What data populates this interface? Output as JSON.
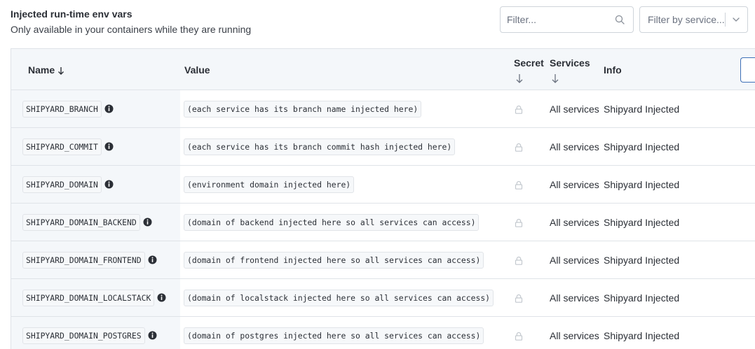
{
  "header": {
    "title": "Injected run-time env vars",
    "subtitle": "Only available in your containers while they are running"
  },
  "filters": {
    "filter_placeholder": "Filter...",
    "service_placeholder": "Filter by service..."
  },
  "table": {
    "columns": {
      "name": "Name",
      "value": "Value",
      "secret": "Secret",
      "services": "Services",
      "info": "Info"
    },
    "rows": [
      {
        "name": "SHIPYARD_BRANCH",
        "value": "(each service has its branch name injected here)",
        "services": "All services",
        "info": "Shipyard Injected"
      },
      {
        "name": "SHIPYARD_COMMIT",
        "value": "(each service has its branch commit hash injected here)",
        "services": "All services",
        "info": "Shipyard Injected"
      },
      {
        "name": "SHIPYARD_DOMAIN",
        "value": "(environment domain injected here)",
        "services": "All services",
        "info": "Shipyard Injected"
      },
      {
        "name": "SHIPYARD_DOMAIN_BACKEND",
        "value": "(domain of backend injected here so all services can access)",
        "services": "All services",
        "info": "Shipyard Injected"
      },
      {
        "name": "SHIPYARD_DOMAIN_FRONTEND",
        "value": "(domain of frontend injected here so all services can access)",
        "services": "All services",
        "info": "Shipyard Injected"
      },
      {
        "name": "SHIPYARD_DOMAIN_LOCALSTACK",
        "value": "(domain of localstack injected here so all services can access)",
        "services": "All services",
        "info": "Shipyard Injected"
      },
      {
        "name": "SHIPYARD_DOMAIN_POSTGRES",
        "value": "(domain of postgres injected here so all services can access)",
        "services": "All services",
        "info": "Shipyard Injected"
      }
    ]
  },
  "icons": {
    "search": "search-icon",
    "chevron": "chevron-down-icon",
    "sort": "arrow-down-icon",
    "info": "info-icon",
    "lock": "lock-icon"
  },
  "colors": {
    "header_bg": "#f4f7fa",
    "border": "#dfe3e8",
    "accent": "#3d6fb6"
  }
}
